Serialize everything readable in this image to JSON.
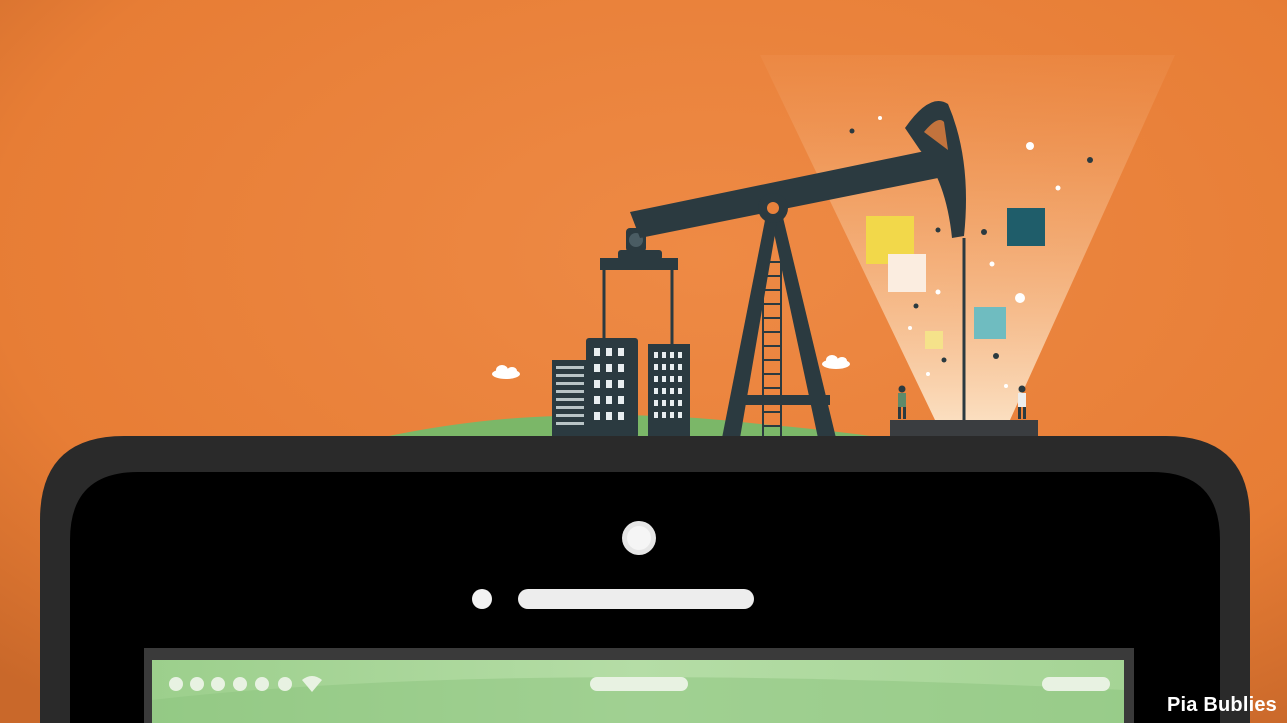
{
  "illustration": {
    "credit": "Pia Bublies",
    "colors": {
      "background": "#E9823C",
      "pumpjack": "#2B3A40",
      "phone_body": "#111111",
      "screen": "#A8D59A",
      "hill": "#7BB768",
      "beam_light": "#F5B07A"
    },
    "icons": {
      "pumpjack": "oil-pumpjack-icon",
      "buildings": "office-buildings-icon",
      "phone": "smartphone-icon",
      "people": "person-icon"
    }
  }
}
